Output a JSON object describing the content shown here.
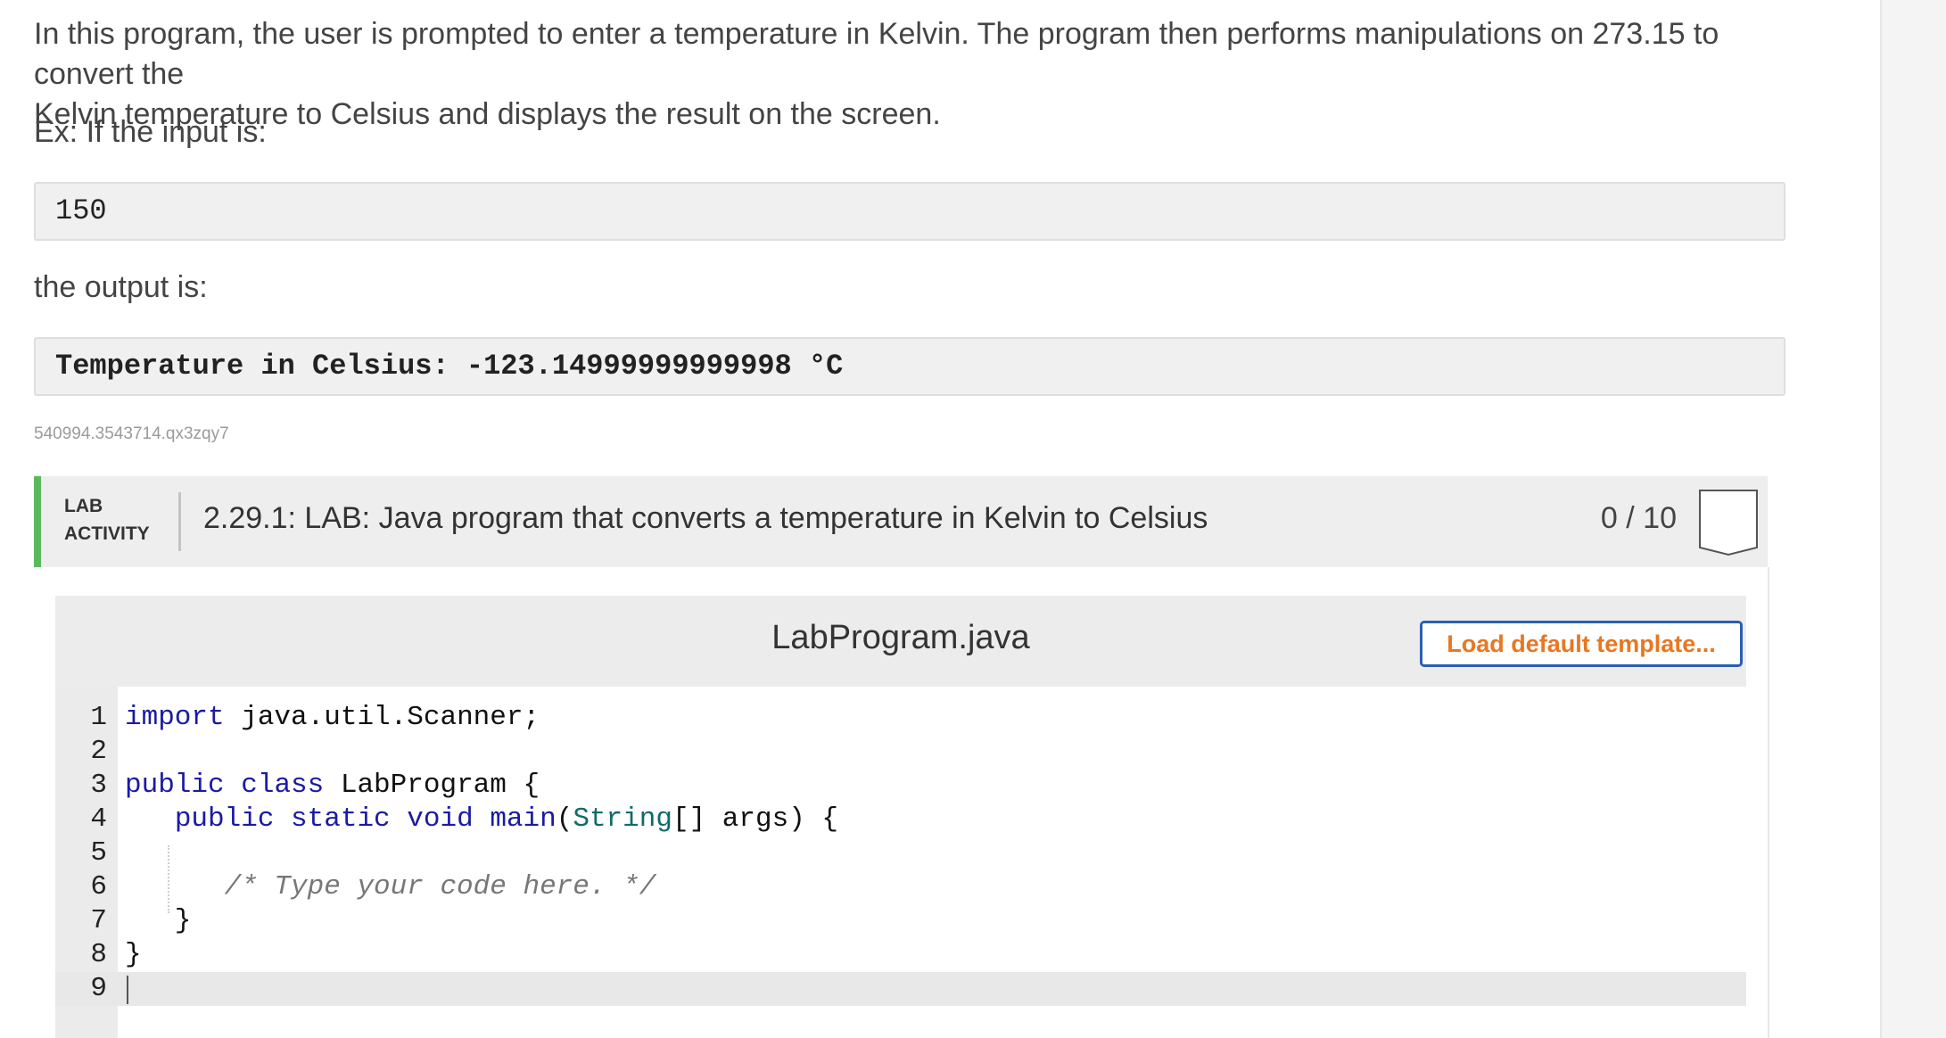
{
  "description": {
    "line1": "In this program, the user is prompted to enter a temperature in Kelvin. The program then performs manipulations on 273.15 to convert the",
    "line2": "Kelvin temperature to Celsius and displays the result on the screen.",
    "example_intro": "Ex: If the input is:",
    "example_input": "150",
    "output_intro": "the output is:",
    "example_output": "Temperature in Celsius: -123.14999999999998 °C",
    "tag": "540994.3543714.qx3zqy7"
  },
  "lab": {
    "label_line1": "LAB",
    "label_line2": "ACTIVITY",
    "title": "2.29.1: LAB: Java program that converts a temperature in Kelvin to Celsius",
    "score": "0 / 10",
    "accent_color": "#5cb85c"
  },
  "editor": {
    "file_name": "LabProgram.java",
    "load_template_label": "Load default template...",
    "lines": [
      {
        "num": "1",
        "text": "import java.util.Scanner;"
      },
      {
        "num": "2",
        "text": ""
      },
      {
        "num": "3",
        "text": "public class LabProgram {"
      },
      {
        "num": "4",
        "text": "   public static void main(String[] args) {"
      },
      {
        "num": "5",
        "text": ""
      },
      {
        "num": "6",
        "text": "      /* Type your code here. */"
      },
      {
        "num": "7",
        "text": "   }"
      },
      {
        "num": "8",
        "text": "}"
      },
      {
        "num": "9",
        "text": ""
      }
    ],
    "active_line": "9"
  }
}
